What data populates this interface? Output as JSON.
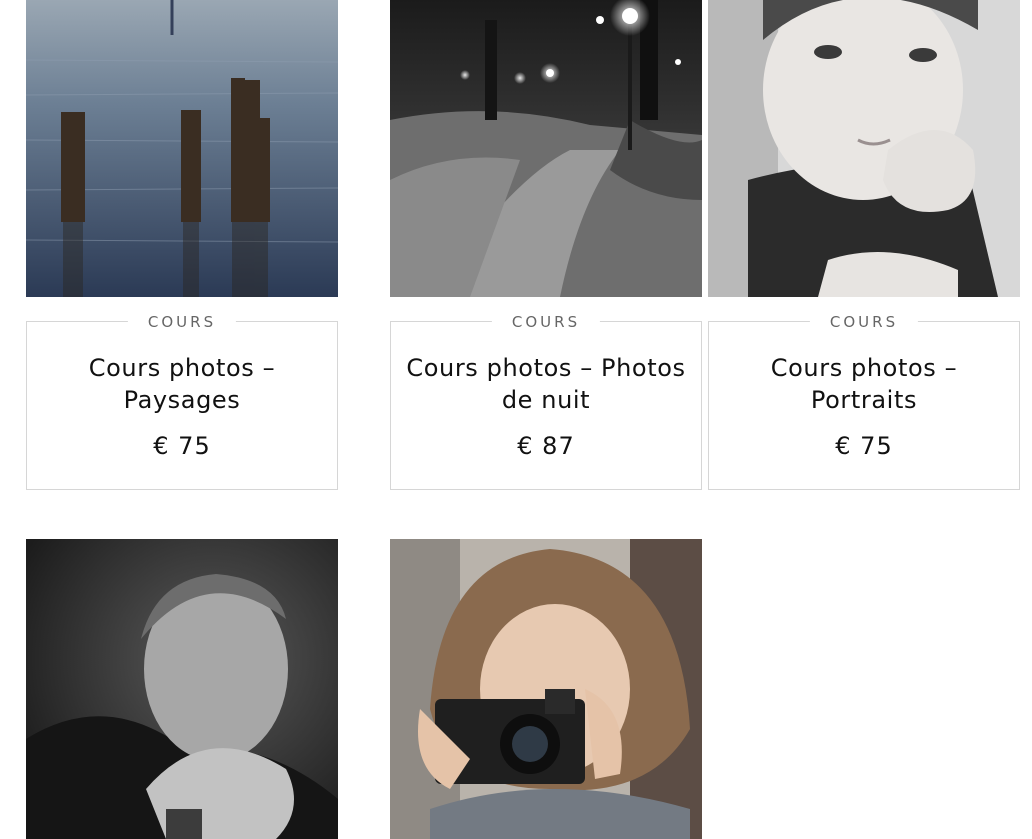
{
  "products": [
    {
      "category": "COURS",
      "title": "Cours photos – Paysages",
      "price": "€ 75",
      "image_icon": "lake-wooden-posts-photo"
    },
    {
      "category": "COURS",
      "title": "Cours photos – Photos de nuit",
      "price": "€ 87",
      "image_icon": "snowy-park-night-photo"
    },
    {
      "category": "COURS",
      "title": "Cours photos – Portraits",
      "price": "€ 75",
      "image_icon": "child-portrait-photo"
    },
    {
      "category": "",
      "title": "",
      "price": "",
      "image_icon": "man-portrait-photo"
    },
    {
      "category": "",
      "title": "",
      "price": "",
      "image_icon": "girl-with-camera-photo"
    }
  ]
}
